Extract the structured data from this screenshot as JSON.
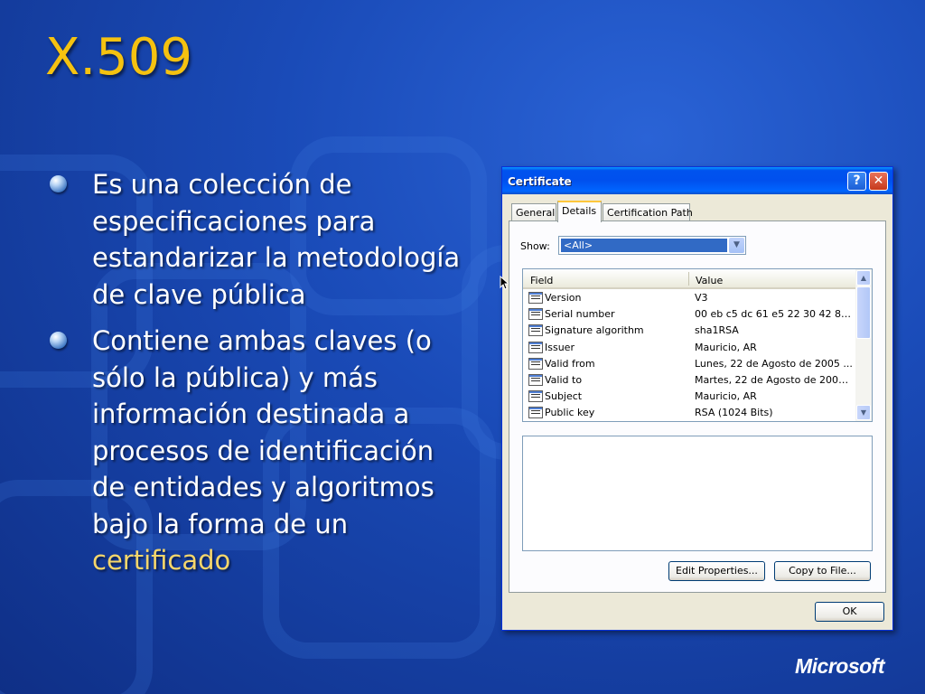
{
  "slide": {
    "title": "X.509",
    "bullets": [
      {
        "text": "Es una colección de especificaciones para estandarizar la metodología de clave pública"
      },
      {
        "text": "Contiene ambas claves (o sólo la pública) y más información destinada a procesos de identificación de entidades y algoritmos bajo la forma de un ",
        "highlight": "certificado"
      }
    ],
    "accent_color": "#f5c210",
    "logo_text": "Microsoft"
  },
  "dialog": {
    "title": "Certificate",
    "help_icon": "help-icon",
    "close_icon": "close-icon",
    "tabs": [
      {
        "label": "General"
      },
      {
        "label": "Details",
        "selected": true
      },
      {
        "label": "Certification Path"
      }
    ],
    "show_label": "Show:",
    "show_value": "<All>",
    "columns": {
      "field": "Field",
      "value": "Value"
    },
    "rows": [
      {
        "field": "Version",
        "value": "V3"
      },
      {
        "field": "Serial number",
        "value": "00 eb c5 dc 61 e5 22 30 42 82..."
      },
      {
        "field": "Signature algorithm",
        "value": "sha1RSA"
      },
      {
        "field": "Issuer",
        "value": "Mauricio, AR"
      },
      {
        "field": "Valid from",
        "value": "Lunes, 22 de Agosto de 2005 ..."
      },
      {
        "field": "Valid to",
        "value": "Martes, 22 de Agosto de 2006..."
      },
      {
        "field": "Subject",
        "value": "Mauricio, AR"
      },
      {
        "field": "Public key",
        "value": "RSA (1024 Bits)"
      }
    ],
    "buttons": {
      "edit_properties": "Edit Properties...",
      "copy_to_file": "Copy to File...",
      "ok": "OK"
    }
  }
}
